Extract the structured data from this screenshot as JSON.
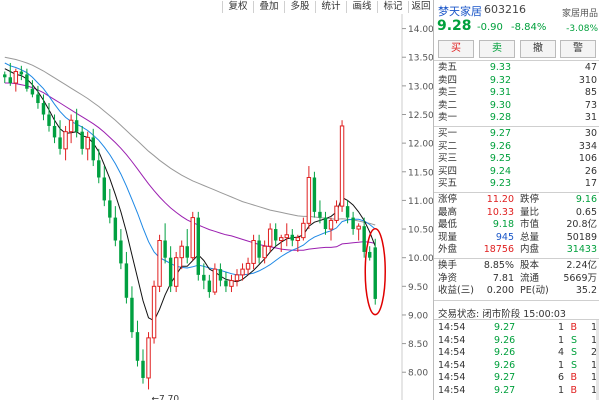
{
  "toolbar": {
    "buttons": [
      "复权",
      "叠加",
      "多股",
      "统计",
      "画线",
      "标记",
      "返回"
    ],
    "close": "×"
  },
  "chart_data": {
    "type": "candlestick",
    "y_ticks": [
      "14.00",
      "13.50",
      "13.00",
      "12.50",
      "12.00",
      "11.50",
      "11.00",
      "10.50",
      "10.00",
      "9.50",
      "9.00",
      "8.50",
      "8.00"
    ],
    "ylim": [
      7.55,
      14.15
    ],
    "low_marker": "←7.70",
    "candles": [
      [
        13.2,
        13.25,
        13.05,
        13.15
      ],
      [
        13.15,
        13.4,
        13.0,
        13.05
      ],
      [
        13.05,
        13.3,
        12.9,
        13.25
      ],
      [
        13.25,
        13.35,
        13.1,
        13.2
      ],
      [
        13.2,
        13.3,
        12.9,
        12.95
      ],
      [
        12.95,
        13.1,
        12.8,
        12.85
      ],
      [
        12.85,
        13.0,
        12.6,
        12.7
      ],
      [
        12.7,
        12.85,
        12.4,
        12.5
      ],
      [
        12.5,
        12.7,
        12.2,
        12.3
      ],
      [
        12.3,
        12.5,
        12.0,
        12.1
      ],
      [
        12.1,
        12.4,
        11.8,
        11.9
      ],
      [
        11.9,
        12.3,
        11.7,
        12.2
      ],
      [
        12.2,
        12.5,
        12.0,
        12.4
      ],
      [
        12.4,
        12.6,
        12.1,
        12.2
      ],
      [
        12.2,
        12.3,
        11.8,
        11.9
      ],
      [
        11.9,
        12.2,
        11.7,
        12.1
      ],
      [
        12.1,
        12.25,
        11.6,
        11.7
      ],
      [
        11.7,
        11.9,
        11.3,
        11.4
      ],
      [
        11.4,
        11.6,
        10.9,
        11.0
      ],
      [
        11.0,
        11.2,
        10.6,
        10.7
      ],
      [
        10.7,
        10.9,
        10.2,
        10.3
      ],
      [
        10.3,
        10.5,
        9.8,
        9.9
      ],
      [
        9.9,
        10.1,
        9.2,
        9.3
      ],
      [
        9.3,
        9.5,
        8.6,
        8.7
      ],
      [
        8.7,
        8.9,
        8.1,
        8.2
      ],
      [
        8.2,
        8.4,
        7.8,
        7.9
      ],
      [
        7.9,
        8.7,
        7.7,
        8.6
      ],
      [
        8.6,
        9.6,
        8.5,
        9.5
      ],
      [
        9.5,
        10.4,
        9.4,
        10.3
      ],
      [
        10.3,
        10.6,
        9.9,
        10.0
      ],
      [
        10.0,
        10.2,
        9.4,
        9.5
      ],
      [
        9.5,
        10.1,
        9.4,
        10.0
      ],
      [
        10.0,
        10.3,
        9.8,
        10.2
      ],
      [
        10.2,
        10.5,
        9.9,
        10.0
      ],
      [
        10.0,
        10.8,
        9.95,
        10.7
      ],
      [
        10.7,
        10.8,
        9.6,
        9.7
      ],
      [
        9.7,
        9.9,
        9.45,
        9.6
      ],
      [
        9.6,
        9.7,
        9.3,
        9.4
      ],
      [
        9.4,
        9.9,
        9.35,
        9.8
      ],
      [
        9.8,
        9.9,
        9.5,
        9.6
      ],
      [
        9.6,
        9.75,
        9.4,
        9.5
      ],
      [
        9.5,
        9.7,
        9.4,
        9.6
      ],
      [
        9.6,
        9.8,
        9.5,
        9.7
      ],
      [
        9.7,
        9.9,
        9.6,
        9.8
      ],
      [
        9.8,
        10.0,
        9.7,
        9.9
      ],
      [
        9.9,
        10.4,
        9.8,
        10.3
      ],
      [
        10.3,
        10.4,
        9.9,
        10.0
      ],
      [
        10.0,
        10.3,
        9.9,
        10.2
      ],
      [
        10.2,
        10.6,
        10.1,
        10.5
      ],
      [
        10.5,
        10.6,
        10.2,
        10.3
      ],
      [
        10.3,
        10.4,
        10.1,
        10.35
      ],
      [
        10.35,
        10.6,
        10.2,
        10.4
      ],
      [
        10.4,
        10.5,
        10.2,
        10.3
      ],
      [
        10.3,
        10.4,
        10.1,
        10.35
      ],
      [
        10.35,
        10.7,
        10.3,
        10.6
      ],
      [
        10.6,
        11.6,
        10.5,
        11.4
      ],
      [
        11.4,
        11.5,
        10.7,
        10.8
      ],
      [
        10.8,
        11.0,
        10.6,
        10.7
      ],
      [
        10.7,
        10.8,
        10.4,
        10.5
      ],
      [
        10.5,
        10.7,
        10.3,
        10.65
      ],
      [
        10.65,
        11.0,
        10.6,
        10.9
      ],
      [
        10.9,
        12.4,
        10.8,
        12.3
      ],
      [
        10.9,
        11.0,
        10.6,
        10.7
      ],
      [
        10.7,
        10.8,
        10.4,
        10.5
      ],
      [
        10.5,
        10.6,
        10.3,
        10.55
      ],
      [
        10.55,
        10.7,
        10.0,
        10.1
      ],
      [
        10.1,
        10.2,
        9.95,
        10.0
      ],
      [
        10.18,
        10.33,
        9.18,
        9.28
      ]
    ],
    "ma_short": [
      13.3,
      13.25,
      13.2,
      13.18,
      13.12,
      13.02,
      12.9,
      12.75,
      12.58,
      12.4,
      12.25,
      12.17,
      12.18,
      12.2,
      12.13,
      12.1,
      12.0,
      11.85,
      11.62,
      11.38,
      11.1,
      10.8,
      10.45,
      10.05,
      9.65,
      9.25,
      8.95,
      8.9,
      9.1,
      9.35,
      9.55,
      9.7,
      9.85,
      9.85,
      9.95,
      10.05,
      9.95,
      9.8,
      9.75,
      9.68,
      9.62,
      9.6,
      9.58,
      9.62,
      9.7,
      9.78,
      9.88,
      9.98,
      10.1,
      10.2,
      10.27,
      10.33,
      10.35,
      10.36,
      10.4,
      10.55,
      10.62,
      10.65,
      10.68,
      10.72,
      10.8,
      11.05,
      11.0,
      10.92,
      10.8,
      10.65,
      10.45,
      10.2
    ],
    "ma_mid": [
      13.4,
      13.35,
      13.32,
      13.28,
      13.23,
      13.15,
      13.05,
      12.95,
      12.82,
      12.68,
      12.55,
      12.45,
      12.38,
      12.33,
      12.28,
      12.22,
      12.14,
      12.05,
      11.93,
      11.8,
      11.64,
      11.46,
      11.25,
      11.02,
      10.78,
      10.52,
      10.28,
      10.1,
      10.0,
      9.95,
      9.9,
      9.85,
      9.83,
      9.82,
      9.84,
      9.87,
      9.85,
      9.82,
      9.8,
      9.78,
      9.75,
      9.72,
      9.7,
      9.7,
      9.71,
      9.73,
      9.77,
      9.82,
      9.88,
      9.95,
      10.02,
      10.08,
      10.13,
      10.17,
      10.22,
      10.3,
      10.36,
      10.4,
      10.44,
      10.47,
      10.52,
      10.63,
      10.66,
      10.67,
      10.67,
      10.64,
      10.58,
      10.5
    ],
    "ma_long": [
      13.05,
      13.05,
      13.04,
      13.02,
      13.0,
      12.97,
      12.93,
      12.88,
      12.82,
      12.76,
      12.7,
      12.64,
      12.58,
      12.52,
      12.46,
      12.4,
      12.34,
      12.27,
      12.19,
      12.1,
      12.01,
      11.91,
      11.8,
      11.68,
      11.55,
      11.42,
      11.29,
      11.17,
      11.06,
      10.96,
      10.87,
      10.79,
      10.72,
      10.66,
      10.61,
      10.57,
      10.53,
      10.49,
      10.46,
      10.43,
      10.4,
      10.38,
      10.35,
      10.32,
      10.29,
      10.26,
      10.23,
      10.21,
      10.19,
      10.17,
      10.15,
      10.14,
      10.13,
      10.13,
      10.13,
      10.15,
      10.16,
      10.17,
      10.18,
      10.18,
      10.19,
      10.24,
      10.25,
      10.26,
      10.27,
      10.28,
      10.27,
      10.25
    ],
    "ma_xlong": [
      13.5,
      13.48,
      13.46,
      13.43,
      13.4,
      13.36,
      13.31,
      13.26,
      13.2,
      13.14,
      13.08,
      13.02,
      12.96,
      12.9,
      12.84,
      12.78,
      12.71,
      12.64,
      12.56,
      12.48,
      12.4,
      12.31,
      12.22,
      12.13,
      12.04,
      11.95,
      11.86,
      11.78,
      11.7,
      11.63,
      11.56,
      11.5,
      11.44,
      11.39,
      11.34,
      11.3,
      11.26,
      11.22,
      11.18,
      11.14,
      11.1,
      11.06,
      11.02,
      10.98,
      10.95,
      10.92,
      10.89,
      10.86,
      10.83,
      10.81,
      10.79,
      10.77,
      10.75,
      10.73,
      10.72,
      10.72,
      10.71,
      10.7,
      10.69,
      10.68,
      10.67,
      10.68,
      10.67,
      10.66,
      10.64,
      10.62,
      10.6,
      10.57
    ],
    "colors": {
      "up": "#e02020",
      "down": "#00a040",
      "ma_short": "#111111",
      "ma_mid": "#1e88e5",
      "ma_long": "#9b1fb0",
      "ma_xlong": "#999999",
      "highlight": "#e00000"
    }
  },
  "panel": {
    "name": "梦天家居",
    "code": "603216",
    "industry": "家居用品",
    "last": "9.28",
    "change": "-0.90",
    "pct": "-8.84%",
    "industry_change": "-3.08%",
    "actions": {
      "buy": "买",
      "sell": "卖",
      "cancel": "撤",
      "alert": "警"
    },
    "asks": [
      {
        "label": "卖五",
        "price": "9.33",
        "vol": "47"
      },
      {
        "label": "卖四",
        "price": "9.32",
        "vol": "310"
      },
      {
        "label": "卖三",
        "price": "9.31",
        "vol": "85"
      },
      {
        "label": "卖二",
        "price": "9.30",
        "vol": "73"
      },
      {
        "label": "卖一",
        "price": "9.28",
        "vol": "31"
      }
    ],
    "bids": [
      {
        "label": "买一",
        "price": "9.27",
        "vol": "30"
      },
      {
        "label": "买二",
        "price": "9.26",
        "vol": "334"
      },
      {
        "label": "买三",
        "price": "9.25",
        "vol": "106"
      },
      {
        "label": "买四",
        "price": "9.24",
        "vol": "26"
      },
      {
        "label": "买五",
        "price": "9.23",
        "vol": "17"
      }
    ],
    "stats": [
      {
        "l1": "涨停",
        "v1": "11.20",
        "c1": "red",
        "l2": "跌停",
        "v2": "9.16",
        "c2": "green"
      },
      {
        "l1": "最高",
        "v1": "10.33",
        "c1": "red",
        "l2": "量比",
        "v2": "0.65",
        "c2": "dark"
      },
      {
        "l1": "最低",
        "v1": "9.18",
        "c1": "green",
        "l2": "市值",
        "v2": "20.8亿",
        "c2": "dark"
      },
      {
        "l1": "现量",
        "v1": "945",
        "c1": "blue",
        "l2": "总量",
        "v2": "50189",
        "c2": "dark"
      },
      {
        "l1": "外盘",
        "v1": "18756",
        "c1": "red",
        "l2": "内盘",
        "v2": "31433",
        "c2": "green"
      },
      {
        "l1": "换手",
        "v1": "8.85%",
        "c1": "dark",
        "l2": "股本",
        "v2": "2.24亿",
        "c2": "dark"
      },
      {
        "l1": "净资",
        "v1": "7.81",
        "c1": "dark",
        "l2": "流通",
        "v2": "5669万",
        "c2": "dark"
      },
      {
        "l1": "收益(三)",
        "v1": "0.200",
        "c1": "dark",
        "l2": "PE(动)",
        "v2": "35.2",
        "c2": "dark"
      }
    ],
    "status": "交易状态: 闭市阶段 15:00:03",
    "trades": [
      {
        "time": "14:54",
        "price": "9.27",
        "vol": "1",
        "dir": "B",
        "n": "1"
      },
      {
        "time": "14:54",
        "price": "9.26",
        "vol": "1",
        "dir": "S",
        "n": "1"
      },
      {
        "time": "14:54",
        "price": "9.26",
        "vol": "4",
        "dir": "S",
        "n": "2"
      },
      {
        "time": "14:54",
        "price": "9.26",
        "vol": "1",
        "dir": "S",
        "n": "1"
      },
      {
        "time": "14:54",
        "price": "9.27",
        "vol": "6",
        "dir": "B",
        "n": "1"
      },
      {
        "time": "14:54",
        "price": "9.27",
        "vol": "1",
        "dir": "B",
        "n": "1"
      }
    ]
  }
}
